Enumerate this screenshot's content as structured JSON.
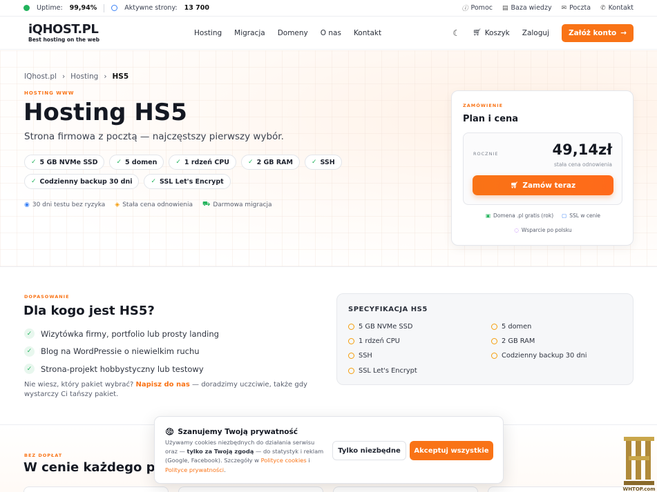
{
  "topbar": {
    "uptime_label": "Uptime:",
    "uptime_value": "99,94%",
    "sites_label": "Aktywne strony:",
    "sites_value": "13 700",
    "links": [
      "Pomoc",
      "Baza wiedzy",
      "Poczta",
      "Kontakt"
    ]
  },
  "nav": {
    "logo_main": "iQHOST.PL",
    "logo_tagline": "Best hosting on the web",
    "menu": [
      "Hosting",
      "Migracja",
      "Domeny",
      "O nas",
      "Kontakt"
    ],
    "cart": "Koszyk",
    "login": "Zaloguj",
    "signup": "Załóż konto"
  },
  "breadcrumb": [
    "IQhost.pl",
    "Hosting",
    "HS5"
  ],
  "hero": {
    "eyebrow": "HOSTING WWW",
    "title": "Hosting HS5",
    "subtitle": "Strona firmowa z pocztą — najczęstszy pierwszy wybór.",
    "chips": [
      "5 GB NVMe SSD",
      "5 domen",
      "1 rdzeń CPU",
      "2 GB RAM",
      "SSH",
      "Codzienny backup 30 dni",
      "SSL Let's Encrypt"
    ],
    "perks": [
      "30 dni testu bez ryzyka",
      "Stała cena odnowienia",
      "Darmowa migracja"
    ]
  },
  "order_card": {
    "eyebrow": "ZAMÓWIENIE",
    "title": "Plan i cena",
    "period": "ROCZNIE",
    "price": "49,14zł",
    "price_note": "stała cena odnowienia",
    "order_button": "Zamów teraz",
    "features_row1": [
      "Domena .pl gratis (rok)",
      "SSL w cenie"
    ],
    "features_row2": [
      "Wsparcie po polsku"
    ]
  },
  "fit_section": {
    "eyebrow": "DOPASOWANIE",
    "title": "Dla kogo jest HS5?",
    "items": [
      "Wizytówka firmy, portfolio lub prosty landing",
      "Blog na WordPressie o niewielkim ruchu",
      "Strona-projekt hobbystyczny lub testowy"
    ],
    "help_prefix": "Nie wiesz, który pakiet wybrać?",
    "help_link": "Napisz do nas",
    "help_suffix": "— doradzimy uczciwie, także gdy wystarczy Ci tańszy pakiet."
  },
  "spec": {
    "title": "SPECYFIKACJA HS5",
    "items": [
      "5 GB NVMe SSD",
      "5 domen",
      "1 rdzeń CPU",
      "2 GB RAM",
      "SSH",
      "Codzienny backup 30 dni",
      "SSL Let's Encrypt"
    ]
  },
  "price_section": {
    "eyebrow": "BEZ DOPŁAT",
    "title": "W cenie każdego pak"
  },
  "cookie": {
    "title": "Szanujemy Twoją prywatność",
    "text_1": "Używamy cookies niezbędnych do działania serwisu oraz —",
    "text_bold": "tylko za Twoją zgodą",
    "text_2": "— do statystyk i reklam (Google, Facebook). Szczegóły w",
    "link_1": "Polityce cookies",
    "text_and": "i",
    "link_2": "Polityce prywatności",
    "text_end": ".",
    "btn_necessary": "Tylko niezbędne",
    "btn_accept": "Akceptuj wszystkie"
  },
  "watermark": {
    "label": "WHTOP.com"
  },
  "colors": {
    "accent": "#f97316",
    "success": "#22b35c",
    "text": "#141822"
  }
}
